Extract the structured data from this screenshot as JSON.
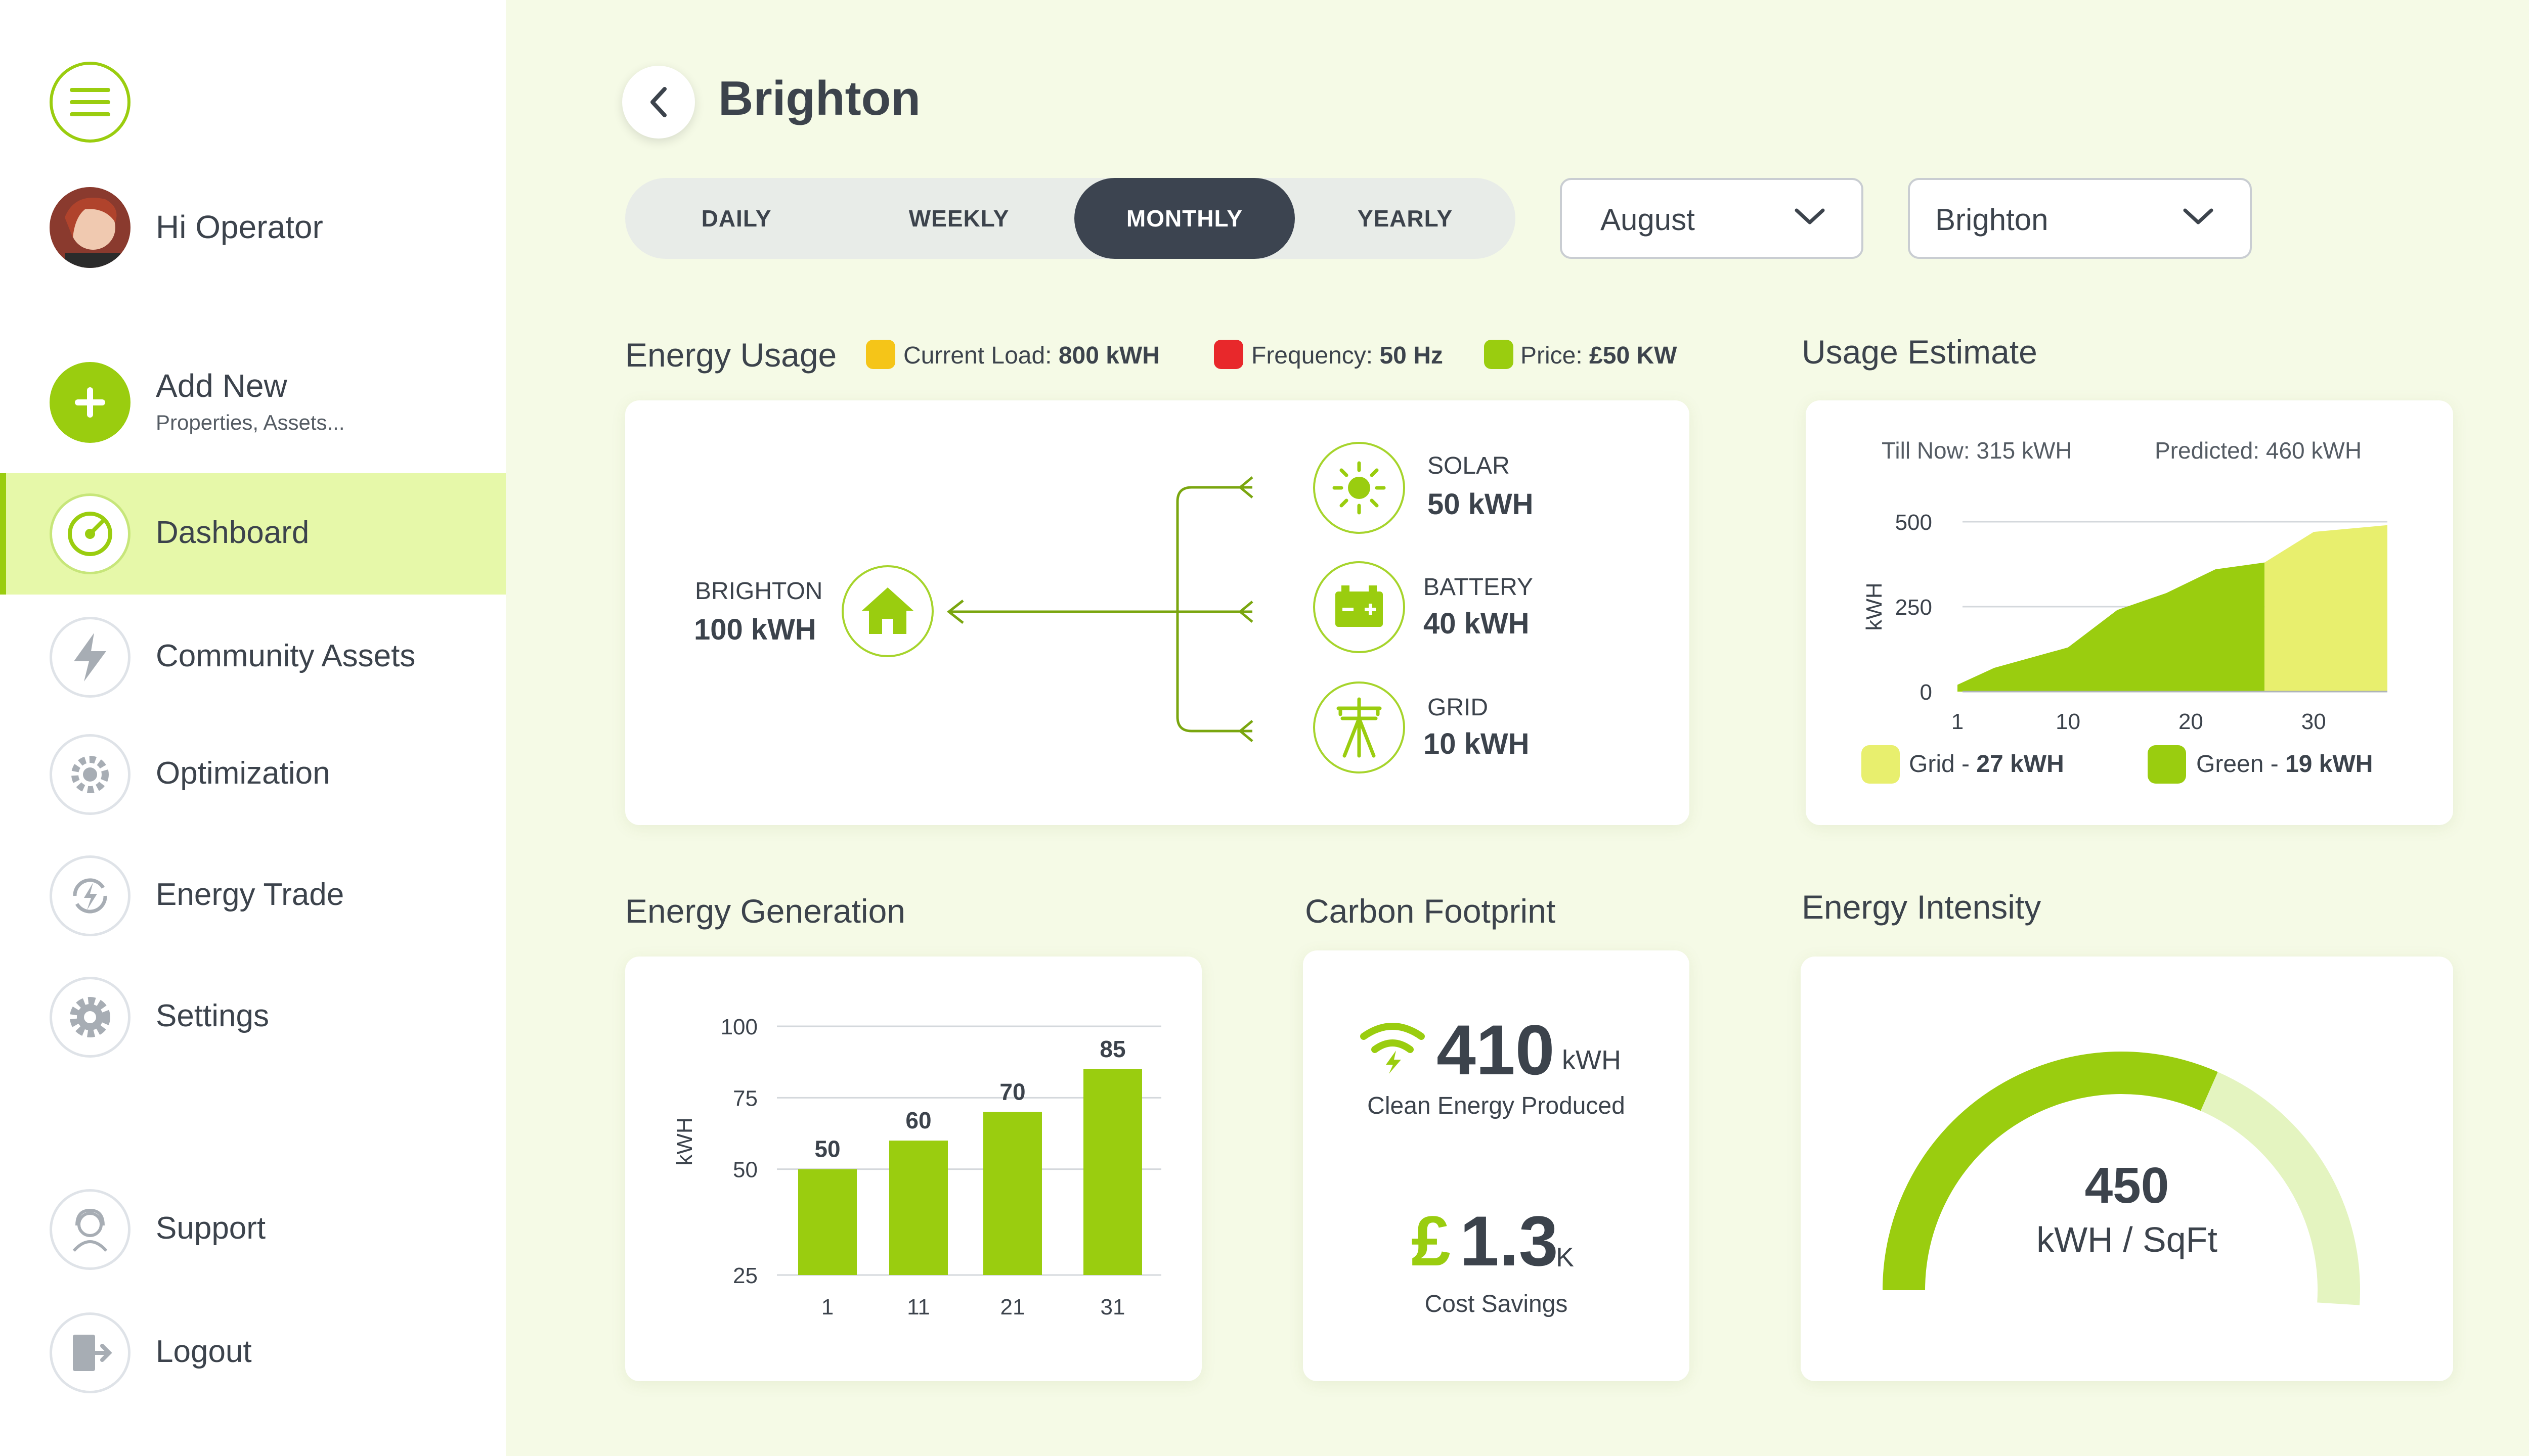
{
  "app": {
    "accent": "#9acd0f",
    "dark": "#3c4450"
  },
  "user": {
    "greeting": "Hi Operator"
  },
  "add_new": {
    "title": "Add New",
    "subtitle": "Properties, Assets..."
  },
  "nav": {
    "items": [
      {
        "label": "Dashboard",
        "icon": "speedometer-icon",
        "active": true
      },
      {
        "label": "Community Assets",
        "icon": "lightning-icon"
      },
      {
        "label": "Optimization",
        "icon": "gear-wrench-icon"
      },
      {
        "label": "Energy Trade",
        "icon": "energy-exchange-icon"
      },
      {
        "label": "Settings",
        "icon": "gear-icon"
      }
    ],
    "support": "Support",
    "logout": "Logout"
  },
  "header": {
    "title": "Brighton"
  },
  "period_tabs": [
    "DAILY",
    "WEEKLY",
    "MONTHLY",
    "YEARLY"
  ],
  "period_active": "MONTHLY",
  "filters": {
    "month": "August",
    "location": "Brighton"
  },
  "energy_usage": {
    "title": "Energy Usage",
    "legend": [
      {
        "label": "Current Load:",
        "value": "800 kWH",
        "color": "#f5c518"
      },
      {
        "label": "Frequency:",
        "value": "50 Hz",
        "color": "#e8282b"
      },
      {
        "label": "Price:",
        "value": "£50 KW",
        "color": "#9acd0f"
      }
    ],
    "home": {
      "label": "BRIGHTON",
      "value": "100 kWH"
    },
    "sources": [
      {
        "label": "SOLAR",
        "value": "50 kWH",
        "icon": "sun-icon"
      },
      {
        "label": "BATTERY",
        "value": "40 kWH",
        "icon": "battery-icon"
      },
      {
        "label": "GRID",
        "value": "10 kWH",
        "icon": "power-pylon-icon"
      }
    ]
  },
  "usage_estimate": {
    "title": "Usage Estimate",
    "till_now": "Till Now: 315 kWH",
    "predicted": "Predicted: 460 kWH",
    "legend": [
      {
        "label": "Grid - ",
        "value": "27 kWH",
        "color": "#e8ef6e"
      },
      {
        "label": "Green - ",
        "value": "19 kWH",
        "color": "#9acd0f"
      }
    ]
  },
  "energy_generation": {
    "title": "Energy Generation"
  },
  "carbon": {
    "title": "Carbon Footprint",
    "clean_value": "410",
    "clean_unit": "kWH",
    "clean_label": "Clean Energy Produced",
    "savings_currency": "£",
    "savings_value": "1.3",
    "savings_unit": "K",
    "savings_label": "Cost Savings"
  },
  "intensity": {
    "title": "Energy Intensity",
    "value": "450",
    "unit": "kWH / SqFt",
    "fraction": 0.62
  },
  "chart_data": [
    {
      "type": "area",
      "ylabel": "kWH",
      "ylim": [
        0,
        500
      ],
      "yticks": [
        0,
        250,
        500
      ],
      "xticks": [
        1,
        10,
        20,
        30
      ],
      "series": [
        {
          "name": "Green",
          "x": [
            1,
            4,
            10,
            14,
            18,
            22,
            26
          ],
          "values": [
            20,
            70,
            130,
            240,
            290,
            360,
            380
          ]
        },
        {
          "name": "Grid",
          "x": [
            26,
            30,
            36
          ],
          "values": [
            380,
            470,
            490
          ]
        }
      ]
    },
    {
      "type": "bar",
      "ylabel": "kWH",
      "categories": [
        "1",
        "11",
        "21",
        "31"
      ],
      "values": [
        50,
        60,
        70,
        85
      ],
      "ylim": [
        25,
        100
      ],
      "yticks": [
        25,
        50,
        75,
        100
      ]
    }
  ]
}
